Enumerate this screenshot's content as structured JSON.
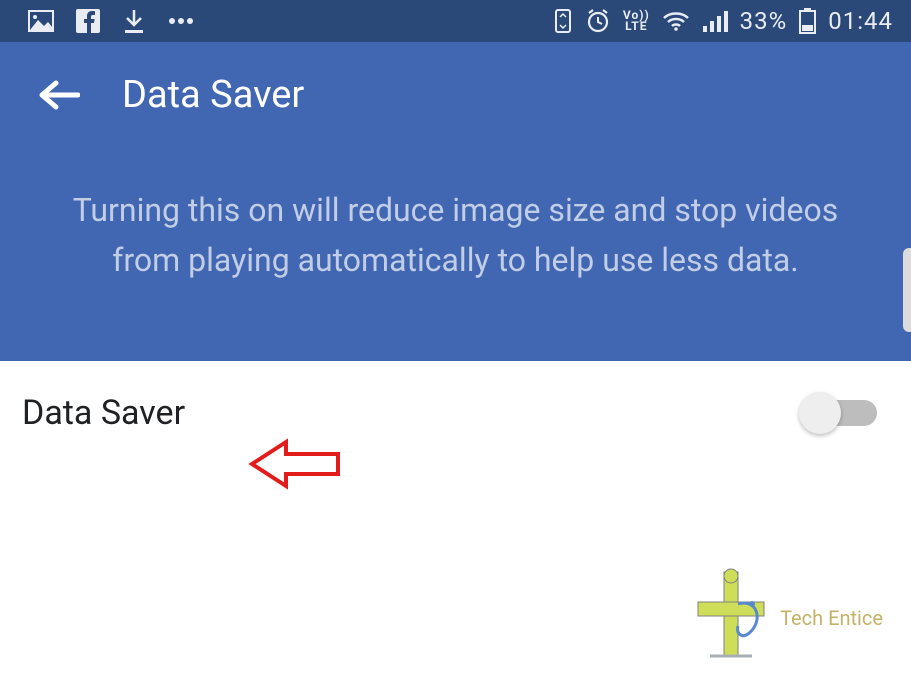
{
  "status_bar": {
    "battery_percent": "33%",
    "time": "01:44",
    "volte_top": "Vo))",
    "volte_bottom": "LTE"
  },
  "app_bar": {
    "title": "Data Saver"
  },
  "description": "Turning this on will reduce image size and stop videos from playing automatically to help use less data.",
  "setting": {
    "label": "Data Saver",
    "toggle_on": false
  },
  "watermark": {
    "text": "Tech Entice"
  }
}
